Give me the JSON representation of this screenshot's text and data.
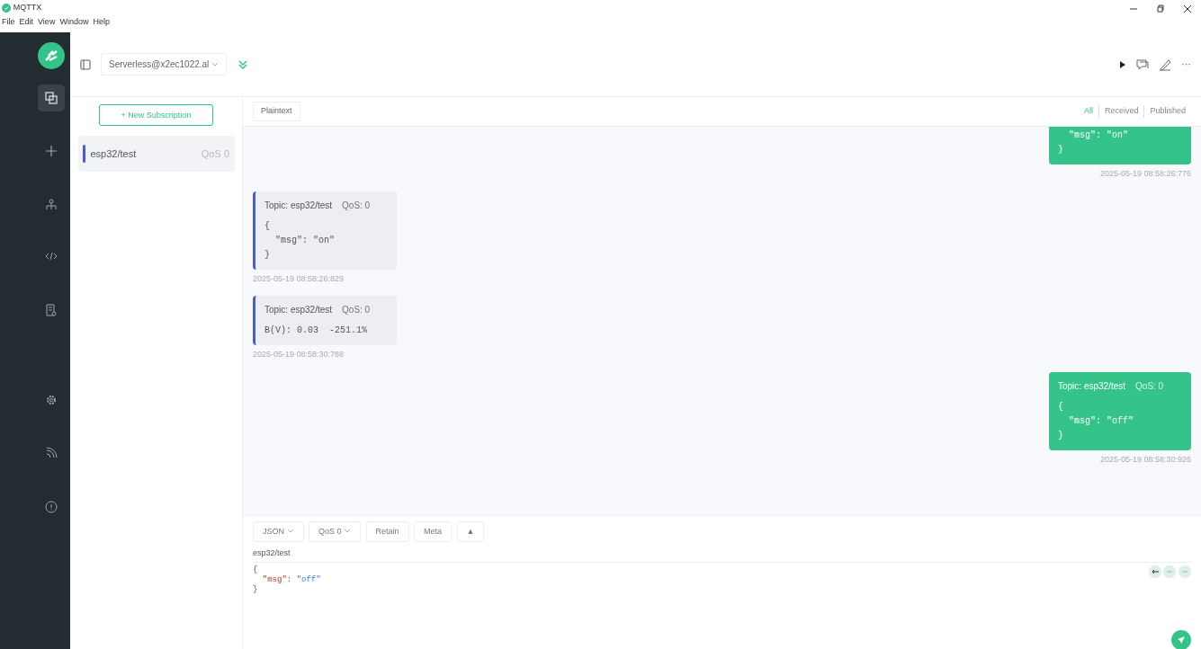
{
  "app": {
    "title": "MQTTX"
  },
  "menu": [
    "File",
    "Edit",
    "View",
    "Window",
    "Help"
  ],
  "sidebar": {
    "items": [
      {
        "kind": "copy",
        "selected": true
      },
      {
        "kind": "plus",
        "selected": false
      },
      {
        "kind": "tree",
        "selected": false
      },
      {
        "kind": "code",
        "selected": false
      },
      {
        "kind": "doc",
        "selected": false
      },
      {
        "kind": "gear",
        "selected": false
      },
      {
        "kind": "feed",
        "selected": false
      },
      {
        "kind": "info",
        "selected": false
      }
    ]
  },
  "connection": {
    "name": "Serverless@x2ec1022.al"
  },
  "toolbar": {
    "more": "···"
  },
  "subscriptions": {
    "new_button": "+ New Subscription",
    "items": [
      {
        "topic": "esp32/test",
        "qos": "QoS 0",
        "color": "#4a5bd1",
        "selected": true
      }
    ]
  },
  "messages_header": {
    "format": "Plaintext",
    "filters": [
      {
        "label": "All",
        "selected": true
      },
      {
        "label": "Received",
        "selected": false
      },
      {
        "label": "Published",
        "selected": false
      }
    ]
  },
  "messages": [
    {
      "kind": "published",
      "lines": [
        "  \"msg\": \"on\"",
        "}"
      ],
      "time": "2025-05-19 08:58:26:776"
    },
    {
      "kind": "received",
      "topic": "Topic: esp32/test",
      "qos": "QoS: 0",
      "lines": [
        "{",
        "  \"msg\": \"on\"",
        "}"
      ],
      "time": "2025-05-19 08:58:26:829"
    },
    {
      "kind": "received",
      "topic": "Topic: esp32/test",
      "qos": "QoS: 0",
      "lines": [
        "B(V): 0.03  -251.1%"
      ],
      "time": "2025-05-19 08:58:30:788"
    },
    {
      "kind": "published",
      "topic": "Topic: esp32/test",
      "qos": "QoS: 0",
      "lines": [
        "{",
        "  \"msg\": \"off\"",
        "}"
      ],
      "time": "2025-05-19 08:58:30:926"
    }
  ],
  "composer": {
    "format": "JSON",
    "qos": "QoS 0",
    "retain": "Retain",
    "meta": "Meta",
    "expand": "▲",
    "topic": "esp32/test",
    "payload": [
      {
        "kind": "plain",
        "text": "{"
      },
      {
        "kind": "pair",
        "key": "\"msg\"",
        "sep": ": ",
        "value": "\"off\""
      },
      {
        "kind": "plain",
        "text": "}"
      }
    ]
  }
}
